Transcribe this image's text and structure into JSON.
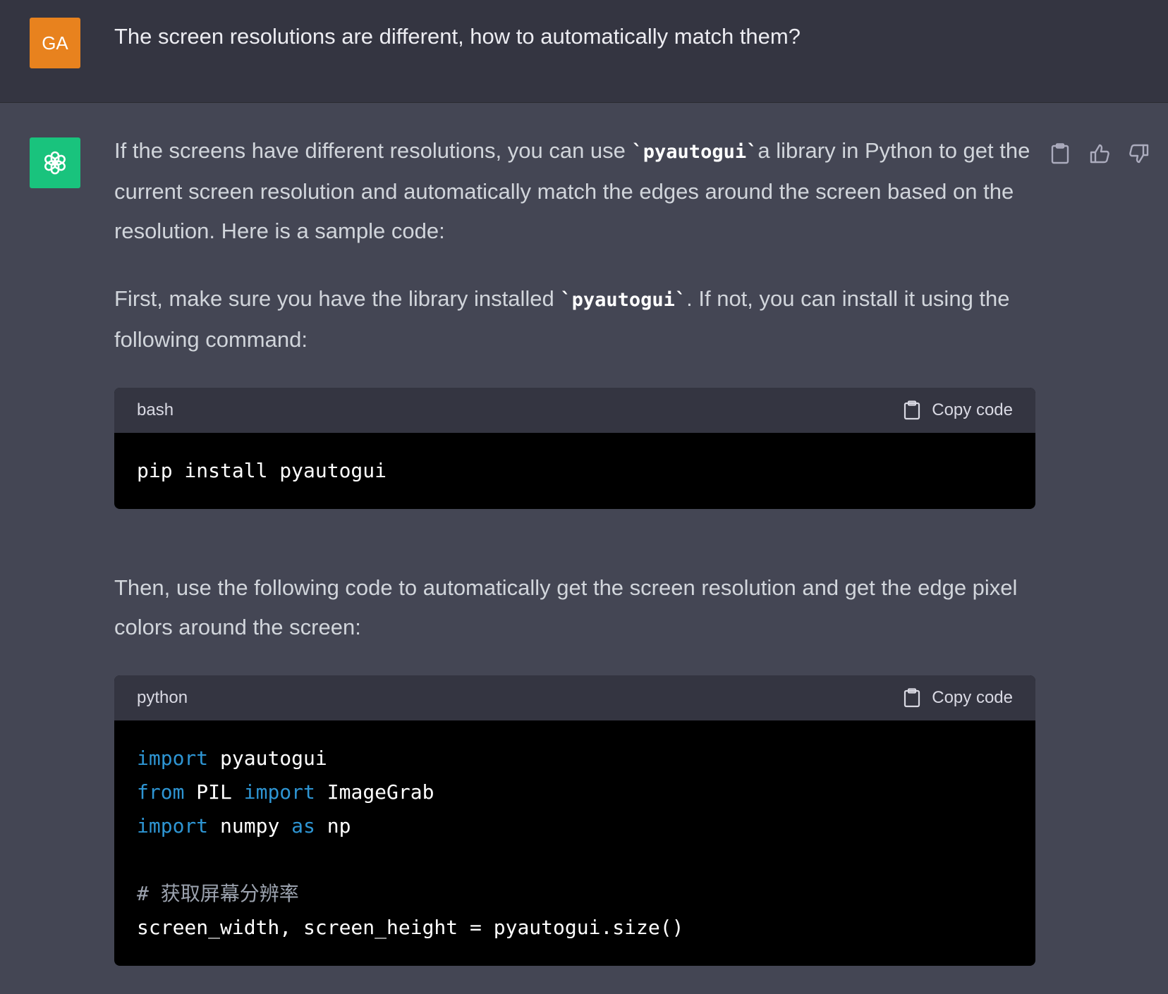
{
  "user_message": {
    "avatar_initials": "GA",
    "avatar_color": "#e8821e",
    "text": "The screen resolutions are different, how to automatically match them?"
  },
  "assistant_message": {
    "avatar_icon": "openai-logo-icon",
    "avatar_color": "#19c37d",
    "actions": [
      "copy-icon",
      "thumbs-up-icon",
      "thumbs-down-icon"
    ],
    "p1": {
      "before": "If the screens have different resolutions, you can use ",
      "code": "`pyautogui`",
      "after": "a library in Python to get the current screen resolution and automatically match the edges around the screen based on the resolution. Here is a sample code:"
    },
    "p2": {
      "before": "First, make sure you have the library installed ",
      "code": "`pyautogui`",
      "after": ". If not, you can install it using the following command:"
    },
    "code1": {
      "language": "bash",
      "copy_label": "Copy code",
      "line1": "pip install pyautogui"
    },
    "p3": "Then, use the following code to automatically get the screen resolution and get the edge pixel colors around the screen:",
    "code2": {
      "language": "python",
      "copy_label": "Copy code",
      "l1_kw": "import",
      "l1_rest": " pyautogui",
      "l2_kw1": "from",
      "l2_mid": " PIL ",
      "l2_kw2": "import",
      "l2_rest": " ImageGrab",
      "l3_kw1": "import",
      "l3_mid": " numpy ",
      "l3_kw2": "as",
      "l3_rest": " np",
      "l5_comment": "# 获取屏幕分辨率",
      "l6": "screen_width, screen_height = pyautogui.size()"
    }
  },
  "colors": {
    "user_bg": "#343541",
    "assistant_bg": "#444654",
    "code_bg": "#000000",
    "keyword": "#2e95d3",
    "comment": "#9ca3af"
  }
}
